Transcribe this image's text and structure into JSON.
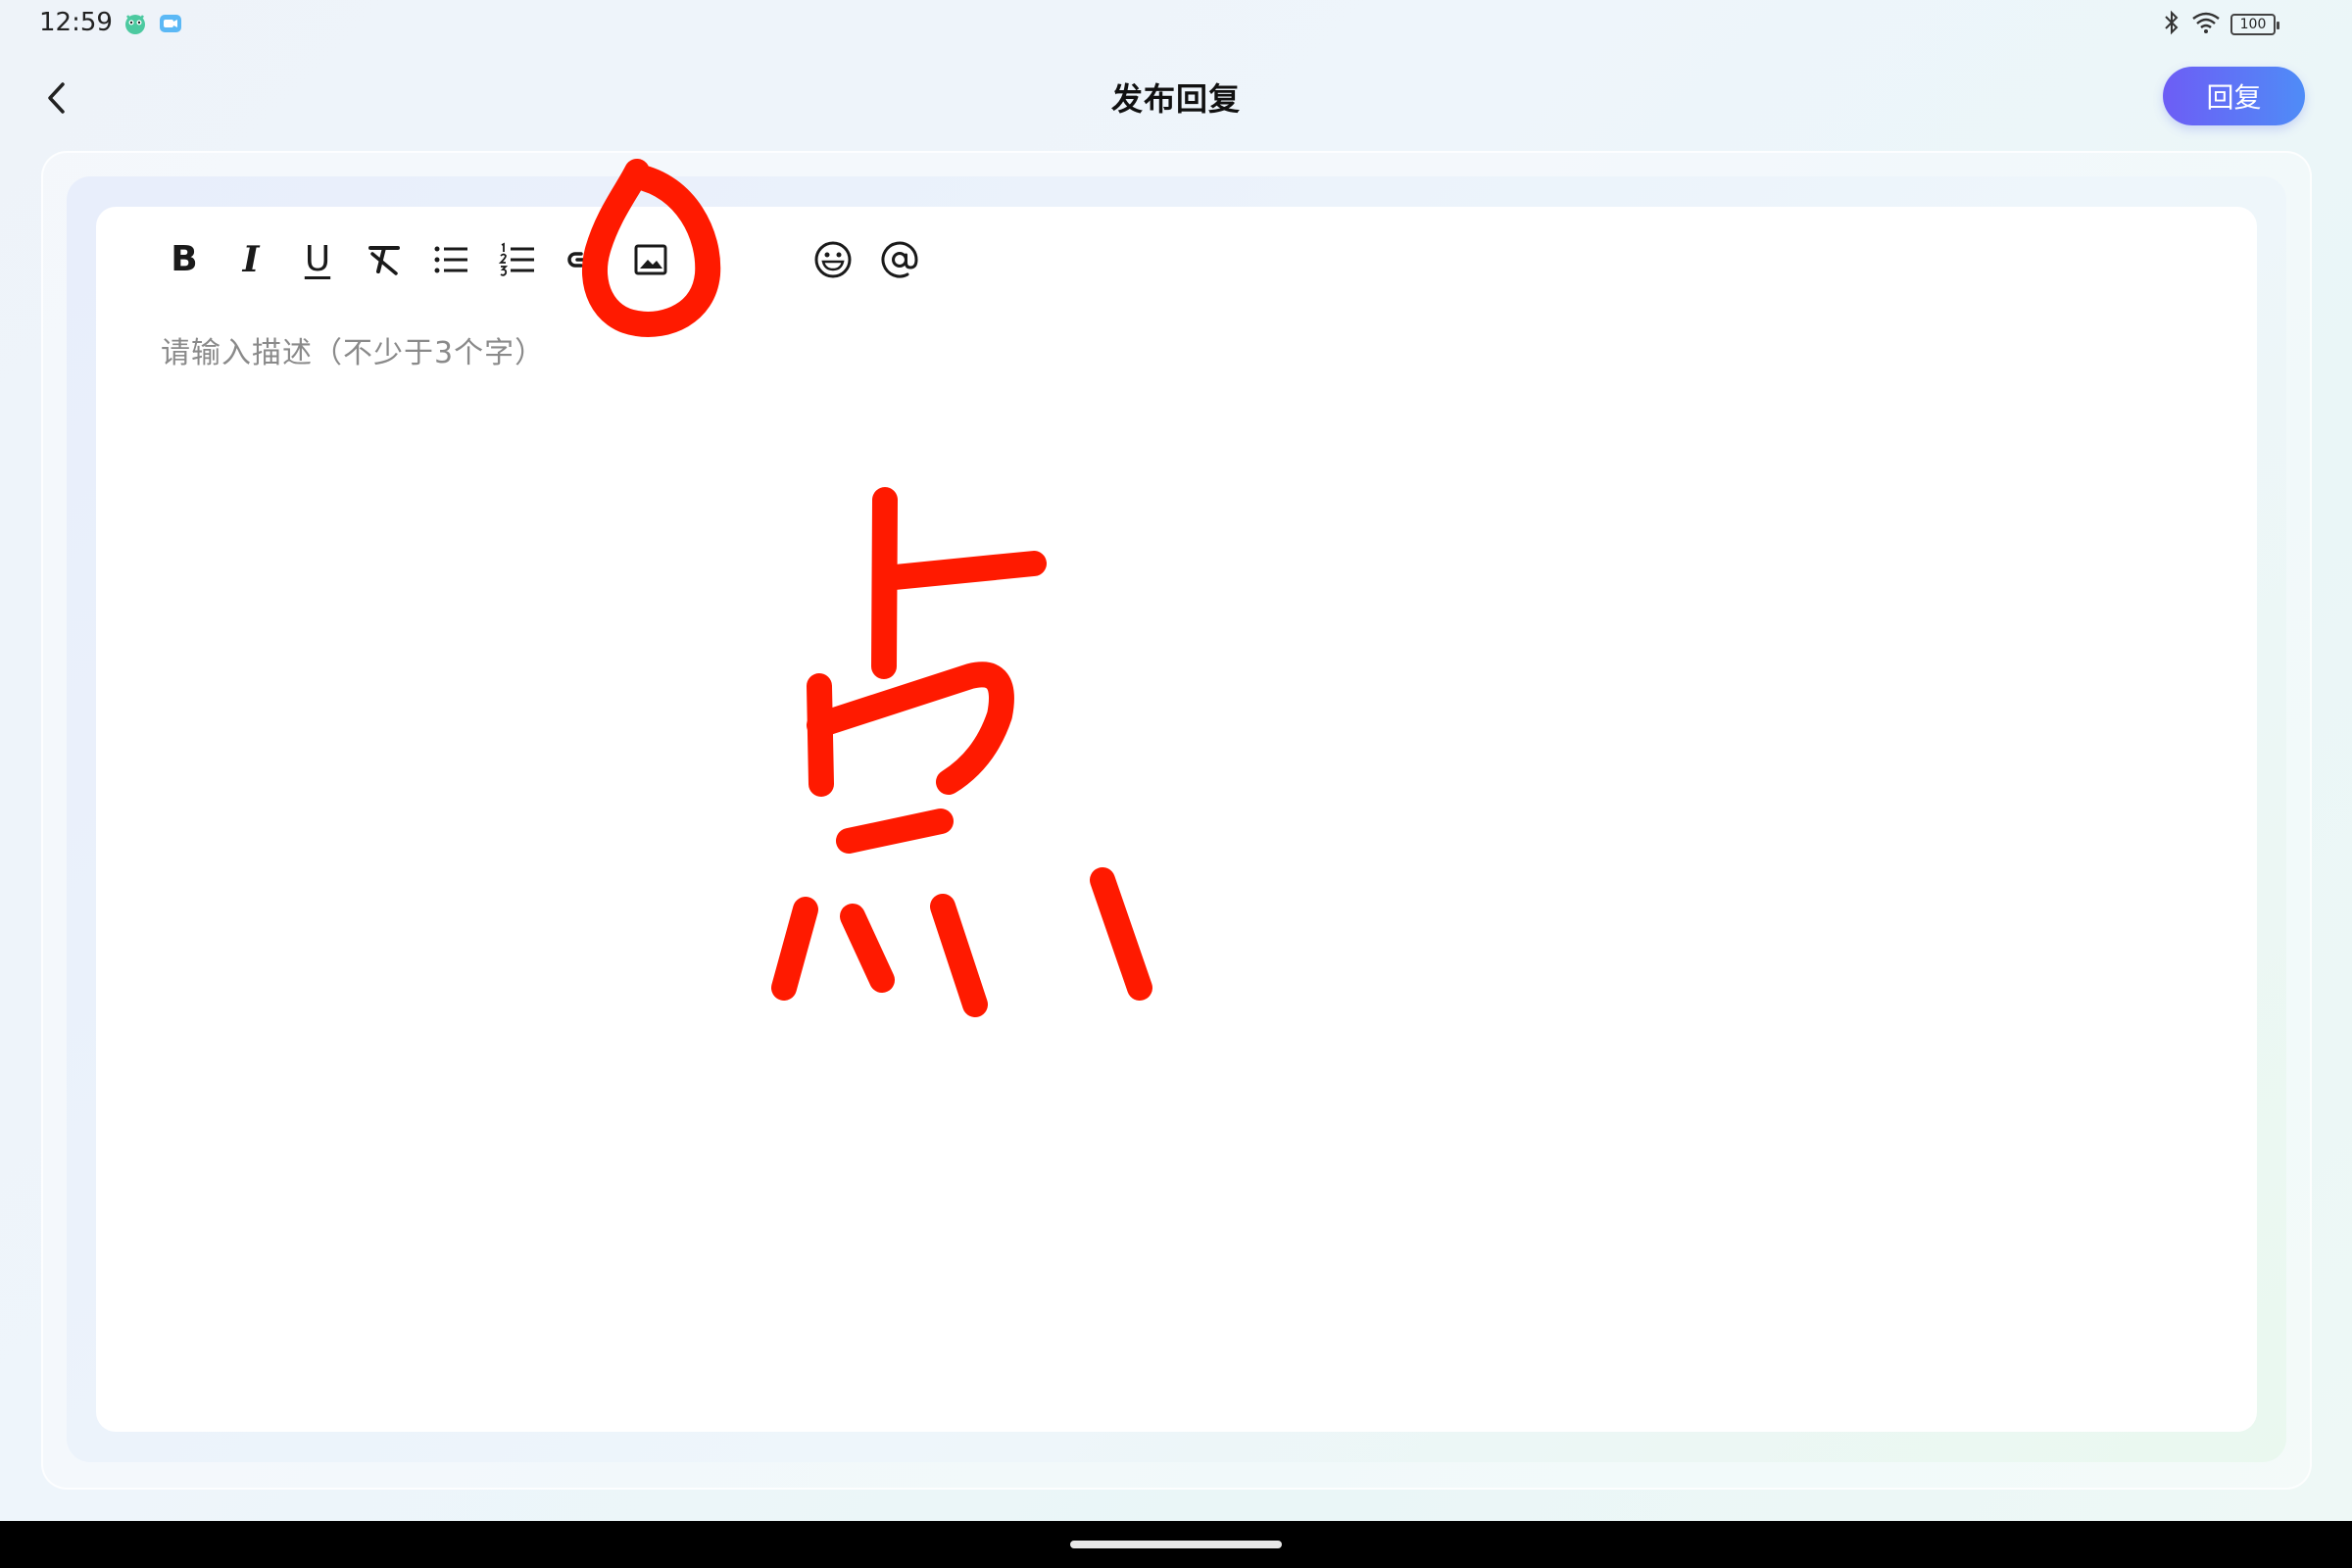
{
  "status": {
    "time": "12:59",
    "battery": "100",
    "notif_icons": [
      "app-mascot-icon",
      "video-call-icon"
    ],
    "right_icons": [
      "bluetooth-icon",
      "wifi-icon",
      "battery-icon"
    ]
  },
  "header": {
    "title": "发布回复",
    "reply_label": "回复"
  },
  "toolbar": {
    "items": [
      "bold-icon",
      "italic-icon",
      "underline-icon",
      "clear-format-icon",
      "bullet-list-icon",
      "numbered-list-icon",
      "link-icon",
      "image-icon",
      "emoji-icon",
      "mention-icon"
    ],
    "bold": "B",
    "italic": "I",
    "underline": "U"
  },
  "editor": {
    "placeholder": "请输入描述（不少于3个字）"
  },
  "colors": {
    "accent_start": "#6d5df5",
    "accent_end": "#4f8cf7",
    "annotation": "#ff1a00"
  }
}
